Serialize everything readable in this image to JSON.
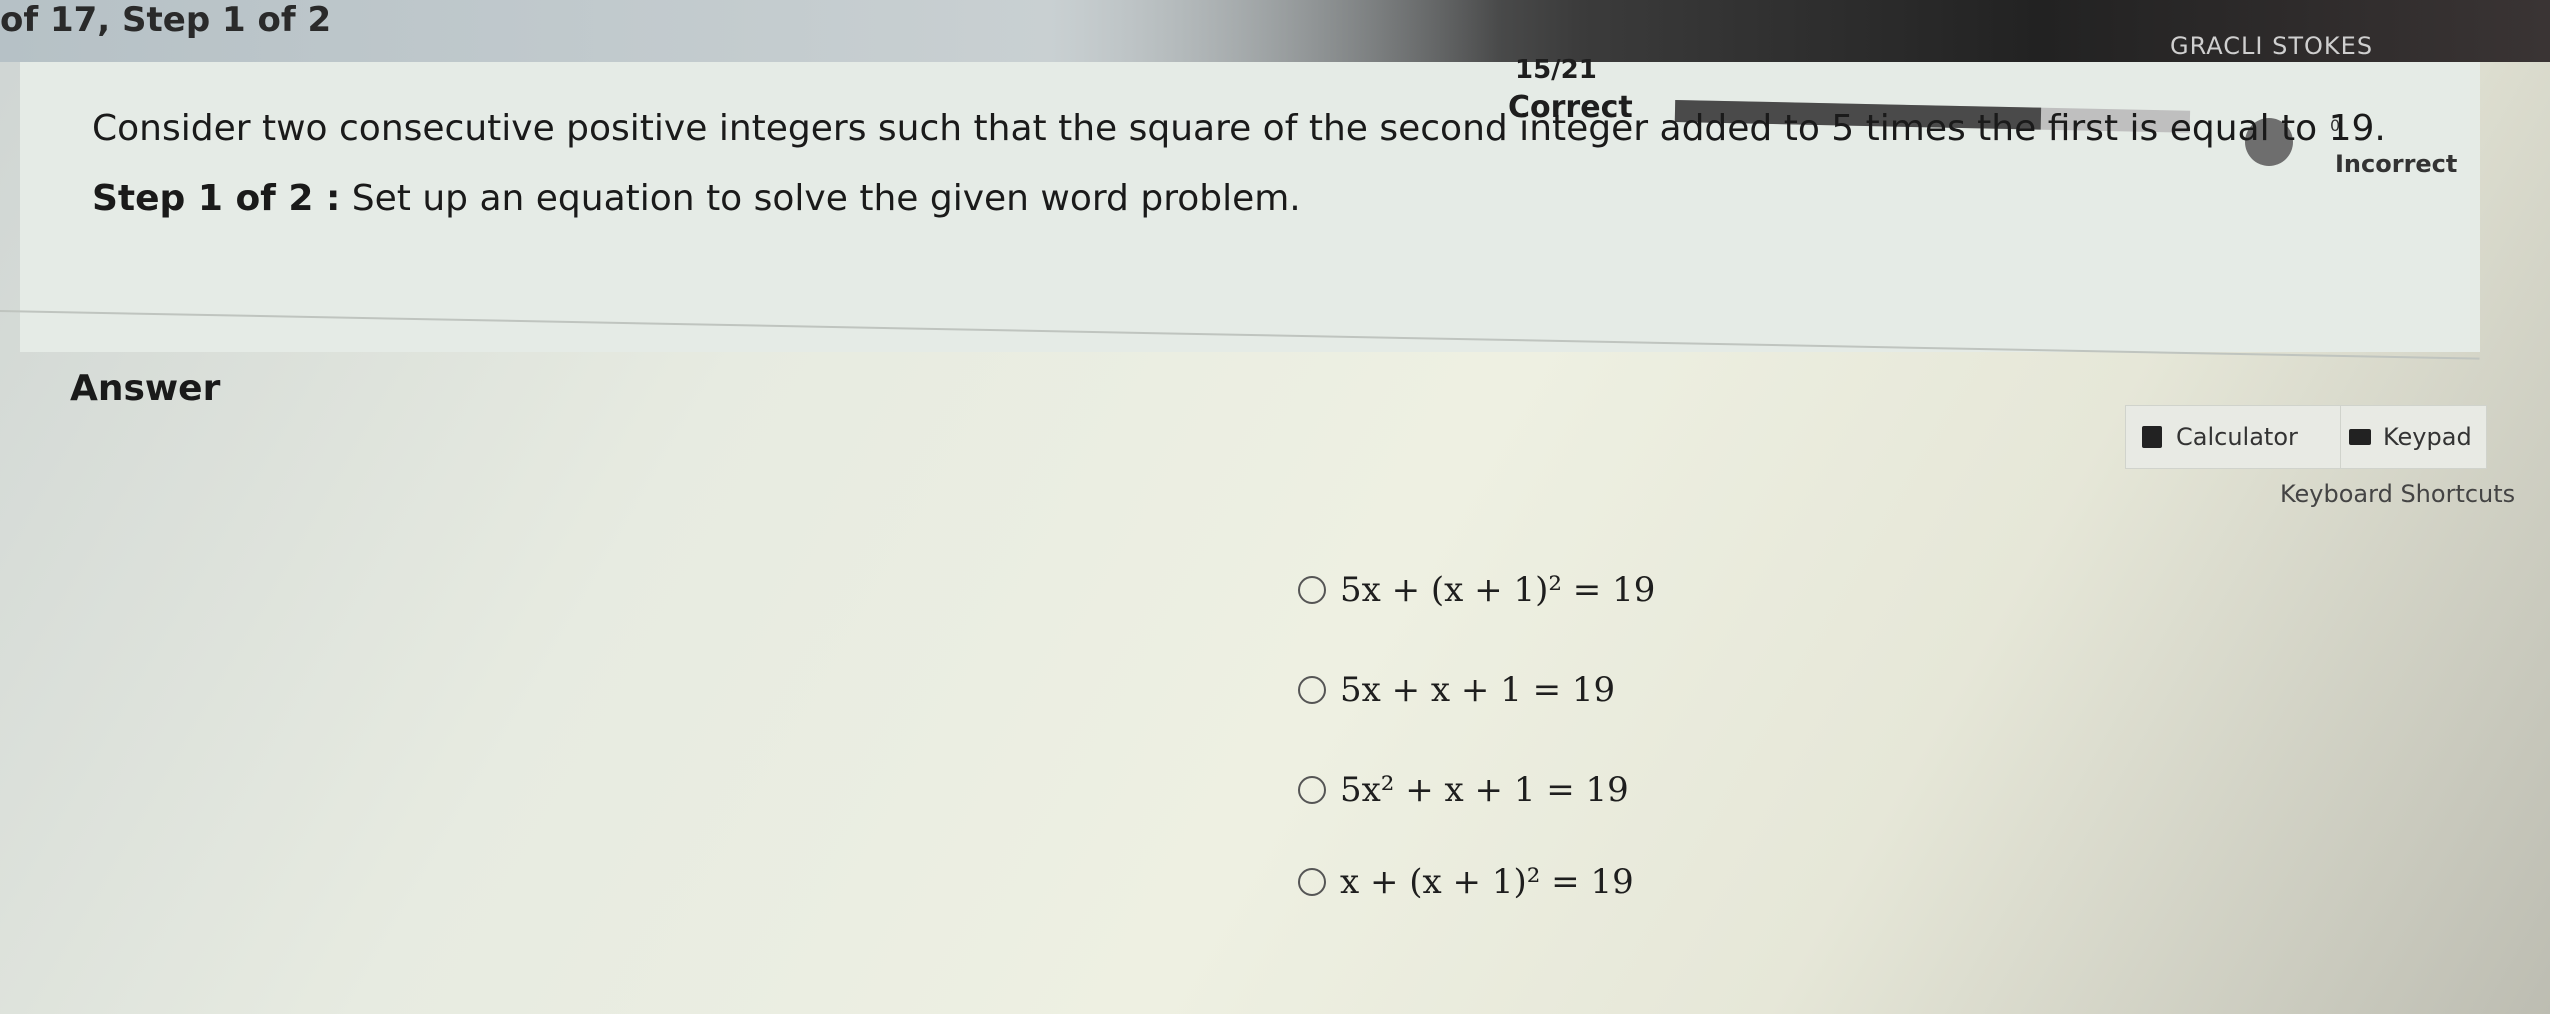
{
  "header": {
    "step_indicator": "of 17, Step 1 of 2",
    "user_name": "GRACLI STOKES",
    "user_caret": "▾"
  },
  "progress": {
    "count_text": "15/21",
    "correct_label": "Correct",
    "incorrect_count": "0",
    "incorrect_label": "Incorrect",
    "fraction": 0.71
  },
  "question": {
    "prompt": "Consider two consecutive positive integers such that the square of the second integer added to 5 times the first is equal to 19.",
    "step_label": "Step 1 of 2 :",
    "step_text": "Set up an equation to solve the given word problem."
  },
  "answer": {
    "heading": "Answer",
    "calculator_label": "Calculator",
    "keypad_label": "Keypad",
    "shortcuts_label": "Keyboard Shortcuts",
    "options": [
      "5x + (x + 1)² = 19",
      "5x + x + 1 = 19",
      "5x² + x + 1 = 19",
      "x + (x + 1)² = 19"
    ]
  }
}
